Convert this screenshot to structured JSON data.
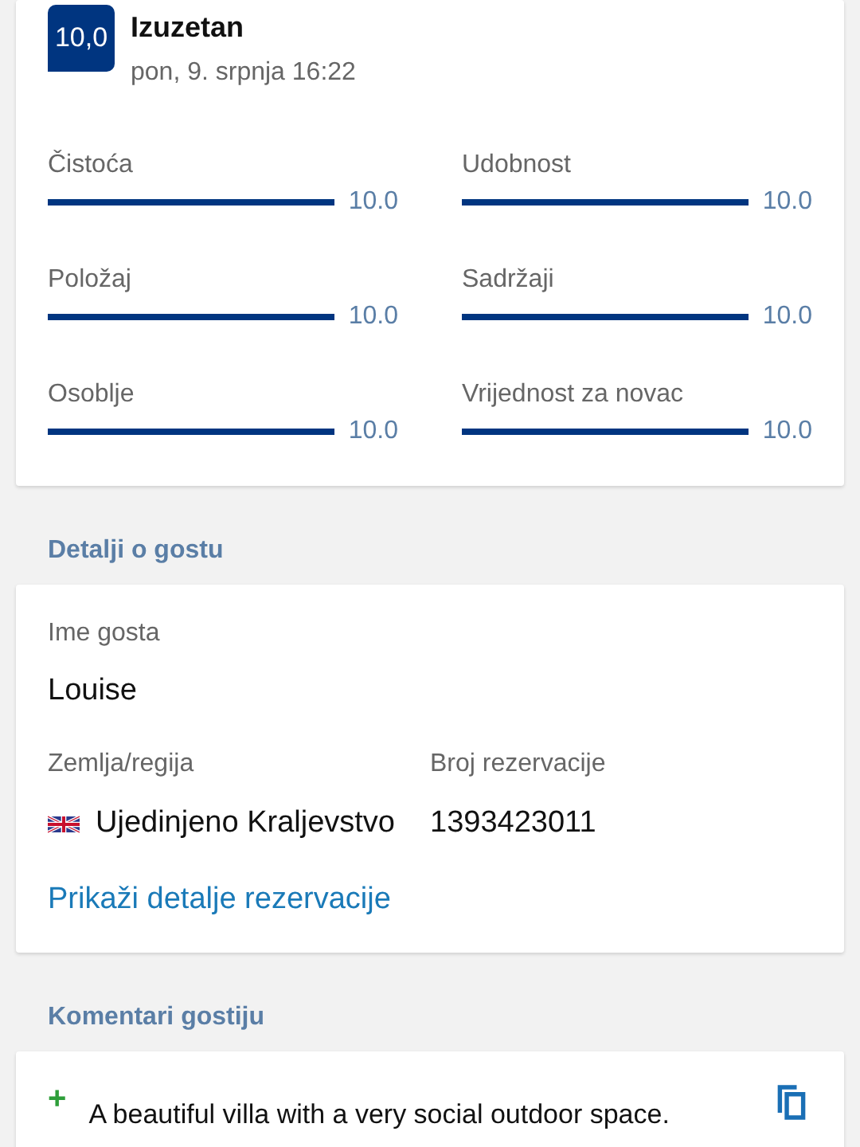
{
  "review": {
    "score": "10,0",
    "verdict": "Izuzetan",
    "date": "pon, 9. srpnja 16:22",
    "categories": [
      {
        "name": "Čistoća",
        "level": 1,
        "value": "10.0"
      },
      {
        "name": "Udobnost",
        "level": 1,
        "value": "10.0"
      },
      {
        "name": "Položaj",
        "level": 1,
        "value": "10.0"
      },
      {
        "name": "Sadržaji",
        "level": 1,
        "value": "10.0"
      },
      {
        "name": "Osoblje",
        "level": 1,
        "value": "10.0"
      },
      {
        "name": "Vrijednost za novac",
        "level": 1,
        "value": "10.0"
      }
    ]
  },
  "guest_details": {
    "heading": "Detalji o gostu",
    "name_label": "Ime gosta",
    "name": "Louise",
    "country_label": "Zemlja/regija",
    "country": "Ujedinjeno Kraljevstvo",
    "booking_label": "Broj rezervacije",
    "booking_number": "1393423011",
    "link": "Prikaži detalje rezervacije"
  },
  "comments": {
    "heading": "Komentari gostiju",
    "items": [
      {
        "kind": "positive",
        "sign": "+",
        "text": "A beautiful villa with a very social outdoor space."
      }
    ]
  }
}
